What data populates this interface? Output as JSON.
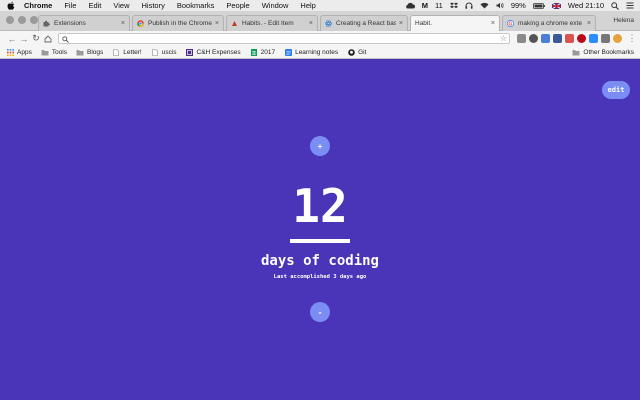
{
  "menubar": {
    "items": [
      "Chrome",
      "File",
      "Edit",
      "View",
      "History",
      "Bookmarks",
      "People",
      "Window",
      "Help"
    ],
    "status": {
      "count": "11",
      "battery": "99%",
      "clock": "Wed 21:10"
    }
  },
  "tabs": [
    {
      "title": "Extensions",
      "icon": "puzzle-icon",
      "active": false
    },
    {
      "title": "Publish in the Chrome",
      "icon": "chrome-icon",
      "active": false
    },
    {
      "title": "Habits. - Edit Item",
      "icon": "app-icon",
      "active": false
    },
    {
      "title": "Creating a React base",
      "icon": "react-icon",
      "active": false
    },
    {
      "title": "Habit.",
      "icon": "",
      "active": true
    },
    {
      "title": "making a chrome exte",
      "icon": "google-icon",
      "active": false
    }
  ],
  "profile": "Helena",
  "omnibox": {
    "value": "",
    "placeholder": ""
  },
  "bookmarks": [
    {
      "label": "Apps",
      "icon": "apps-grid-icon"
    },
    {
      "label": "Tools",
      "icon": "folder-icon"
    },
    {
      "label": "Blogs",
      "icon": "folder-icon"
    },
    {
      "label": "Letter!",
      "icon": "page-icon"
    },
    {
      "label": "uscis",
      "icon": "page-icon"
    },
    {
      "label": "C&H Expenses",
      "icon": "ch-icon"
    },
    {
      "label": "2017",
      "icon": "sheet-icon"
    },
    {
      "label": "Learning notes",
      "icon": "doc-icon"
    },
    {
      "label": "Git",
      "icon": "github-icon"
    }
  ],
  "other_bookmarks": "Other Bookmarks",
  "habit": {
    "edit_label": "edit",
    "increment_label": "+",
    "decrement_label": "-",
    "count": "12",
    "name": "days of coding",
    "last": "Last accomplished 3 days ago"
  },
  "colors": {
    "background": "#4a35b8",
    "button": "#7b8df2"
  }
}
